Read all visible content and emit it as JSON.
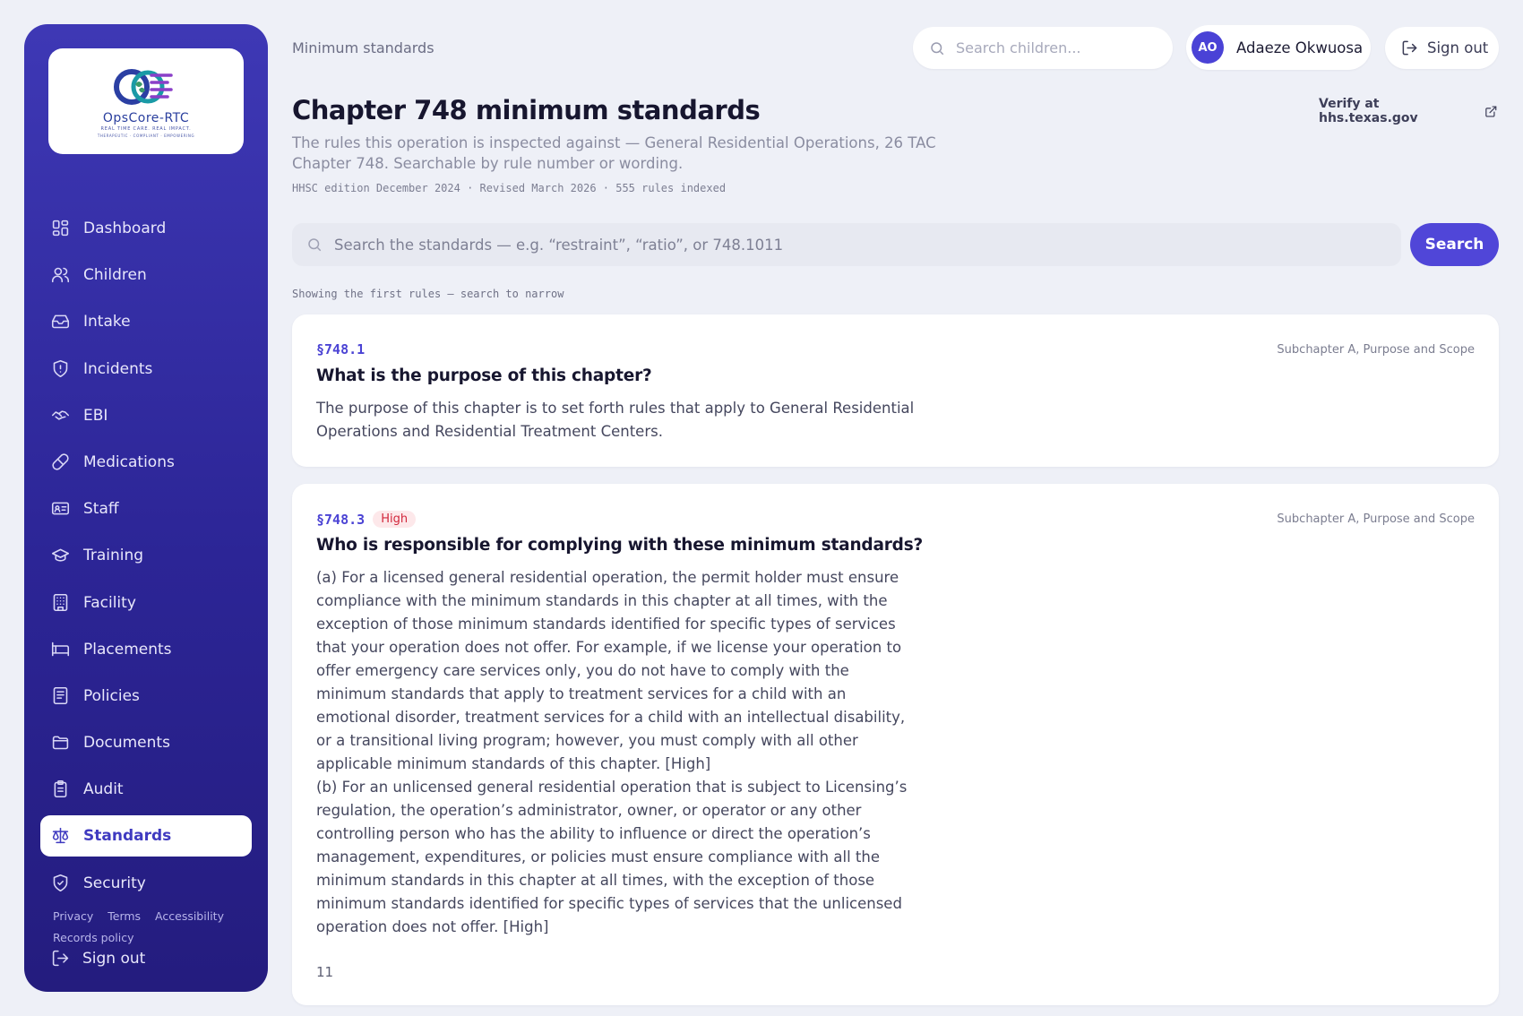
{
  "brand": {
    "name": "OpsCore-RTC",
    "tagline": "REAL TIME CARE. REAL IMPACT.",
    "subtagline": "THERAPEUTIC · COMPLIANT · EMPOWERING"
  },
  "sidebar": {
    "items": [
      {
        "label": "Dashboard",
        "icon": "dashboard-icon"
      },
      {
        "label": "Children",
        "icon": "users-icon"
      },
      {
        "label": "Intake",
        "icon": "inbox-icon"
      },
      {
        "label": "Incidents",
        "icon": "shield-alert-icon"
      },
      {
        "label": "EBI",
        "icon": "handshake-icon"
      },
      {
        "label": "Medications",
        "icon": "pill-icon"
      },
      {
        "label": "Staff",
        "icon": "id-card-icon"
      },
      {
        "label": "Training",
        "icon": "graduation-cap-icon"
      },
      {
        "label": "Facility",
        "icon": "building-icon"
      },
      {
        "label": "Placements",
        "icon": "bed-icon"
      },
      {
        "label": "Policies",
        "icon": "document-icon"
      },
      {
        "label": "Documents",
        "icon": "folder-icon"
      },
      {
        "label": "Audit",
        "icon": "clipboard-icon"
      },
      {
        "label": "Standards",
        "icon": "scale-icon",
        "active": true
      },
      {
        "label": "Security",
        "icon": "shield-check-icon"
      }
    ],
    "footer_links": [
      "Privacy",
      "Terms",
      "Accessibility",
      "Records policy"
    ],
    "signout_label": "Sign out"
  },
  "topbar": {
    "breadcrumb": "Minimum standards",
    "search_placeholder": "Search children...",
    "user": {
      "initials": "AO",
      "name": "Adaeze Okwuosa"
    },
    "signout_label": "Sign out"
  },
  "header": {
    "title": "Chapter 748 minimum standards",
    "description": "The rules this operation is inspected against — General Residential Operations, 26 TAC Chapter 748. Searchable by rule number or wording.",
    "meta": "HHSC edition December 2024 · Revised March 2026 · 555 rules indexed",
    "verify_link": "Verify at hhs.texas.gov"
  },
  "search": {
    "placeholder": "Search the standards — e.g. “restraint”, “ratio”, or 748.1011",
    "button_label": "Search",
    "hint": "Showing the first rules — search to narrow"
  },
  "rules": [
    {
      "number": "§748.1",
      "badge": "",
      "subchapter": "Subchapter A, Purpose and Scope",
      "title": "What is the purpose of this chapter?",
      "body": "The purpose of this chapter is to set forth rules that apply to General Residential Operations and Residential Treatment Centers."
    },
    {
      "number": "§748.3",
      "badge": "High",
      "subchapter": "Subchapter A, Purpose and Scope",
      "title": "Who is responsible for complying with these minimum standards?",
      "body_a": "(a) For a licensed general residential operation, the permit holder must ensure compliance with the minimum standards in this chapter at all times, with the exception of those minimum standards identified for specific types of services that your operation does not offer. For example, if we license your operation to offer emergency care services only, you do not have to comply with the minimum standards that apply to treatment services for a child with an emotional disorder, treatment services for a child with an intellectual disability, or a transitional living program; however, you must comply with all other applicable minimum standards of this chapter. [High]",
      "body_b": "(b) For an unlicensed general residential operation that is subject to Licensing’s regulation, the operation’s administrator, owner, or operator or any other controlling person who has the ability to influence or direct the operation’s management, expenditures, or policies must ensure compliance with all the minimum standards in this chapter at all times, with the exception of those minimum standards identified for specific types of services that the unlicensed operation does not offer. [High]",
      "footnote": "11"
    }
  ],
  "colors": {
    "accent": "#5046d8",
    "sidebar_top": "#3e38b5",
    "sidebar_bottom": "#241c7e",
    "badge_high_bg": "#fde8ea",
    "badge_high_text": "#d2273c"
  }
}
